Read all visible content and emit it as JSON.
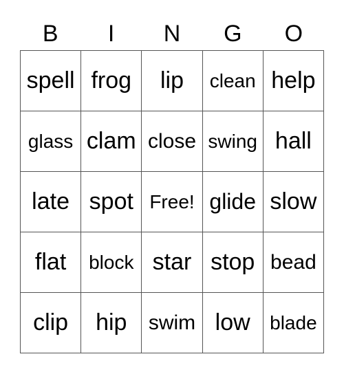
{
  "header": [
    "B",
    "I",
    "N",
    "G",
    "O"
  ],
  "rows": [
    [
      "spell",
      "frog",
      "lip",
      "clean",
      "help"
    ],
    [
      "glass",
      "clam",
      "close",
      "swing",
      "hall"
    ],
    [
      "late",
      "spot",
      "Free!",
      "glide",
      "slow"
    ],
    [
      "flat",
      "block",
      "star",
      "stop",
      "bead"
    ],
    [
      "clip",
      "hip",
      "swim",
      "low",
      "blade"
    ]
  ]
}
